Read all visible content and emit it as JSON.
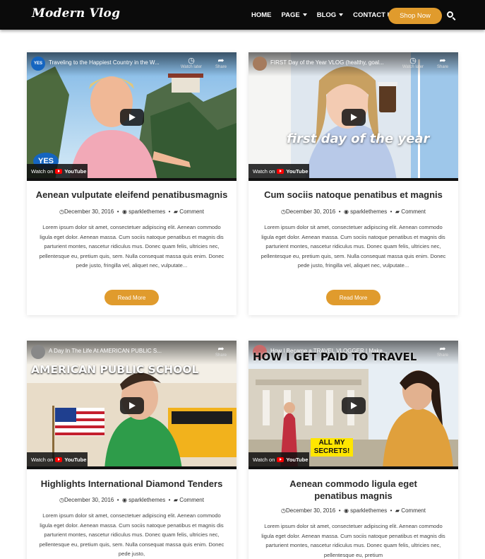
{
  "header": {
    "logo": "Modern Vlog",
    "nav": [
      {
        "label": "HOME"
      },
      {
        "label": "PAGE"
      },
      {
        "label": "BLOG"
      },
      {
        "label": "CONTACT US"
      }
    ],
    "shop_button": "Shop Now"
  },
  "video_ui": {
    "watch_later": "Watch later",
    "share": "Share",
    "watch_on": "Watch on",
    "youtube": "YouTube"
  },
  "posts": [
    {
      "video_title": "Traveling to the Happiest Country in the W...",
      "channel": "YES",
      "overlay_text": "",
      "title": "Aenean vulputate eleifend penatibusmagnis",
      "date": "December 30, 2016",
      "author": "sparklethemes",
      "comment": "Comment",
      "excerpt": "Lorem ipsum dolor sit amet, consectetuer adipiscing elit. Aenean commodo ligula eget dolor. Aenean massa. Cum sociis natoque penatibus et magnis dis parturient montes, nascetur ridiculus mus. Donec quam felis, ultricies nec, pellentesque eu, pretium quis, sem. Nulla consequat massa quis enim. Donec pede justo, fringilla vel, aliquet nec, vulputate...",
      "read_more": "Read More"
    },
    {
      "video_title": "FIRST Day of the Year VLOG (healthy, goal...",
      "channel": "",
      "overlay_text": "first day of the year",
      "title": "Cum sociis natoque penatibus et magnis",
      "date": "December 30, 2016",
      "author": "sparklethemes",
      "comment": "Comment",
      "excerpt": "Lorem ipsum dolor sit amet, consectetuer adipiscing elit. Aenean commodo ligula eget dolor. Aenean massa. Cum sociis natoque penatibus et magnis dis parturient montes, nascetur ridiculus mus. Donec quam felis, ultricies nec, pellentesque eu, pretium quis, sem. Nulla consequat massa quis enim. Donec pede justo, fringilla vel, aliquet nec, vulputate...",
      "read_more": "Read More"
    },
    {
      "video_title": "A Day In The Life At AMERICAN PUBLIC S...",
      "channel": "",
      "overlay_text": "AMERICAN PUBLIC SCHOOL",
      "title": "Highlights International Diamond Tenders",
      "date": "December 30, 2016",
      "author": "sparklethemes",
      "comment": "Comment",
      "excerpt": "Lorem ipsum dolor sit amet, consectetuer adipiscing elit. Aenean commodo ligula eget dolor. Aenean massa. Cum sociis natoque penatibus et magnis dis parturient montes, nascetur ridiculus mus. Donec quam felis, ultricies nec, pellentesque eu, pretium quis, sem. Nulla consequat massa quis enim. Donec pede justo,",
      "read_more": ""
    },
    {
      "video_title": "How I Became a TRAVEL VLOGGER | Make...",
      "channel": "",
      "overlay_text": "HOW I GET PAID TO TRAVEL",
      "overlay_text_2": "ALL MY SECRETS!",
      "title": "Aenean commodo ligula eget penatibus magnis",
      "date": "December 30, 2016",
      "author": "sparklethemes",
      "comment": "Comment",
      "excerpt": "Lorem ipsum dolor sit amet, consectetuer adipiscing elit. Aenean commodo ligula eget dolor. Aenean massa. Cum sociis natoque penatibus et magnis dis parturient montes, nascetur ridiculus mus. Donec quam felis, ultricies nec, pellentesque eu, pretium",
      "read_more": ""
    }
  ]
}
